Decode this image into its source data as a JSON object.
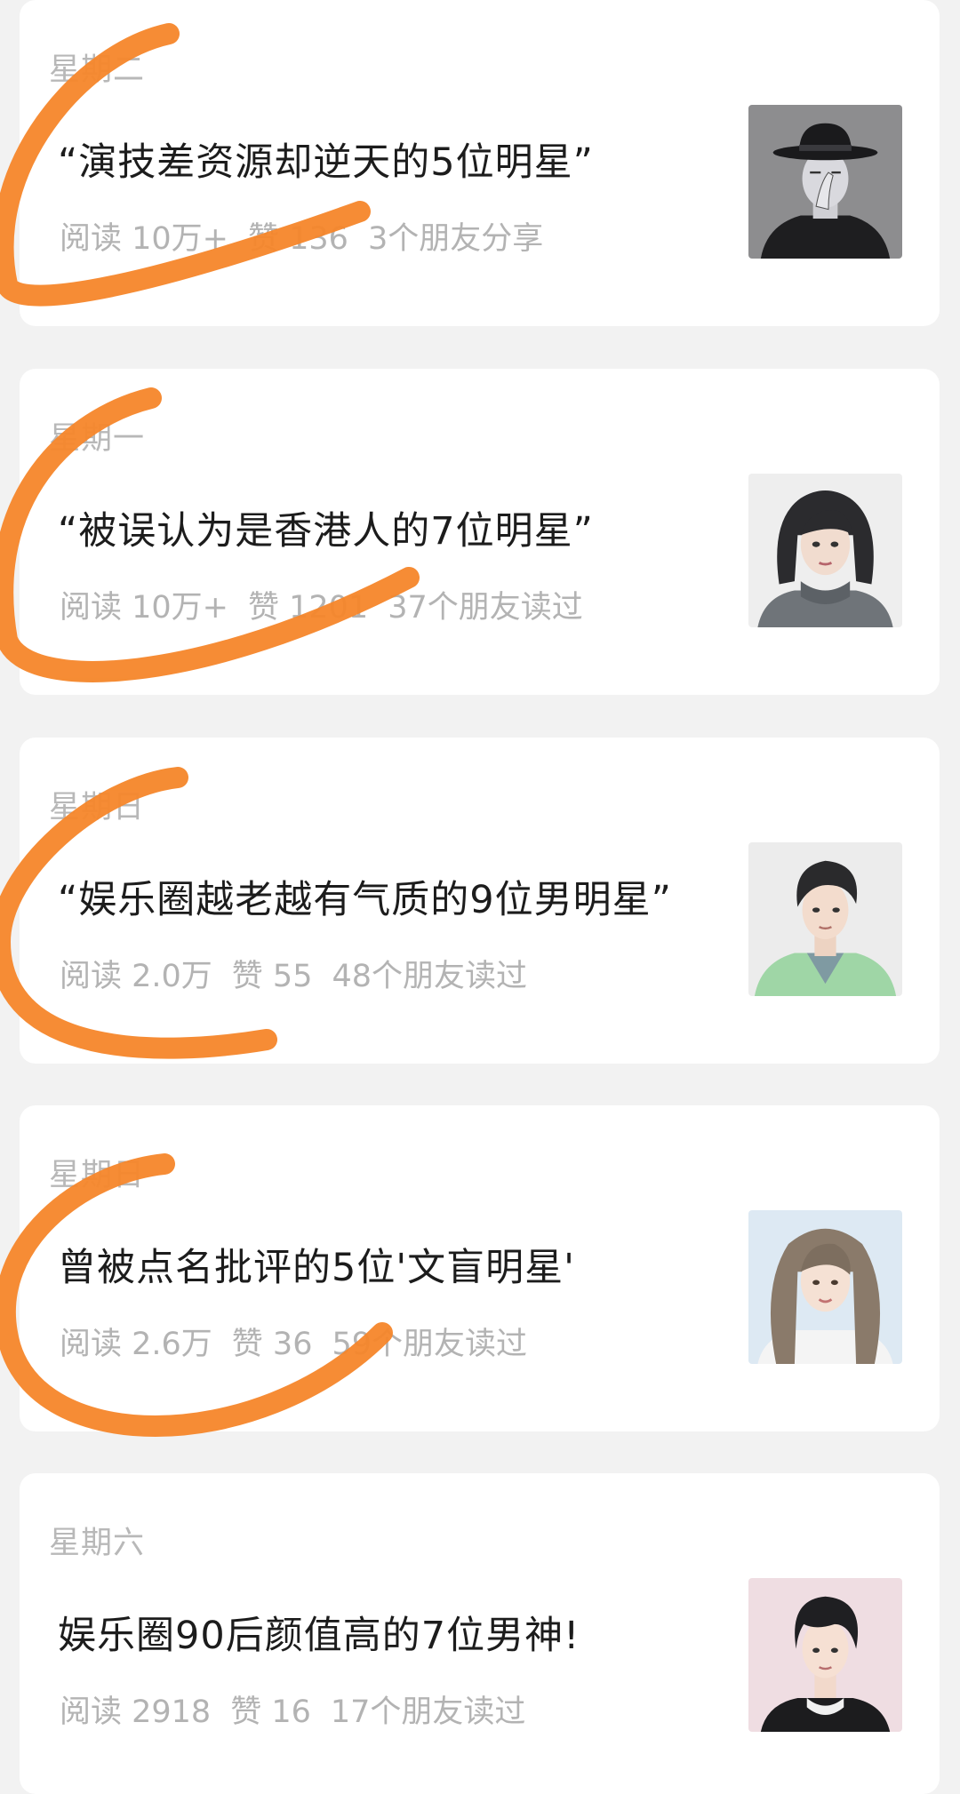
{
  "articles": [
    {
      "day": "星期二",
      "title": "“演技差资源却逆天的5位明星”",
      "reads": "阅读 10万+",
      "likes": "赞 136",
      "social": "3个朋友分享",
      "thumb_icon": "man-in-fedora-avatar-icon"
    },
    {
      "day": "星期一",
      "title": "“被误认为是香港人的7位明星”",
      "reads": "阅读 10万+",
      "likes": "赞 1201",
      "social": "37个朋友读过",
      "thumb_icon": "short-haired-woman-avatar-icon"
    },
    {
      "day": "星期日",
      "title": "“娱乐圈越老越有气质的9位男明星”",
      "reads": "阅读 2.0万",
      "likes": "赞 55",
      "social": "48个朋友读过",
      "thumb_icon": "man-in-green-jacket-avatar-icon"
    },
    {
      "day": "星期日",
      "title": "曾被点名批评的5位'文盲明星'",
      "reads": "阅读 2.6万",
      "likes": "赞 36",
      "social": "59个朋友读过",
      "thumb_icon": "long-haired-woman-avatar-icon"
    },
    {
      "day": "星期六",
      "title": "娱乐圈90后颜值高的7位男神!",
      "reads": "阅读 2918",
      "likes": "赞 16",
      "social": "17个朋友读过",
      "thumb_icon": "young-man-avatar-icon"
    }
  ],
  "colors": {
    "page_background": "#f2f2f2",
    "card_background": "#ffffff",
    "title_text": "#1c1c1c",
    "meta_text": "#b3b3b3",
    "annotation_stroke": "#f5862a"
  }
}
